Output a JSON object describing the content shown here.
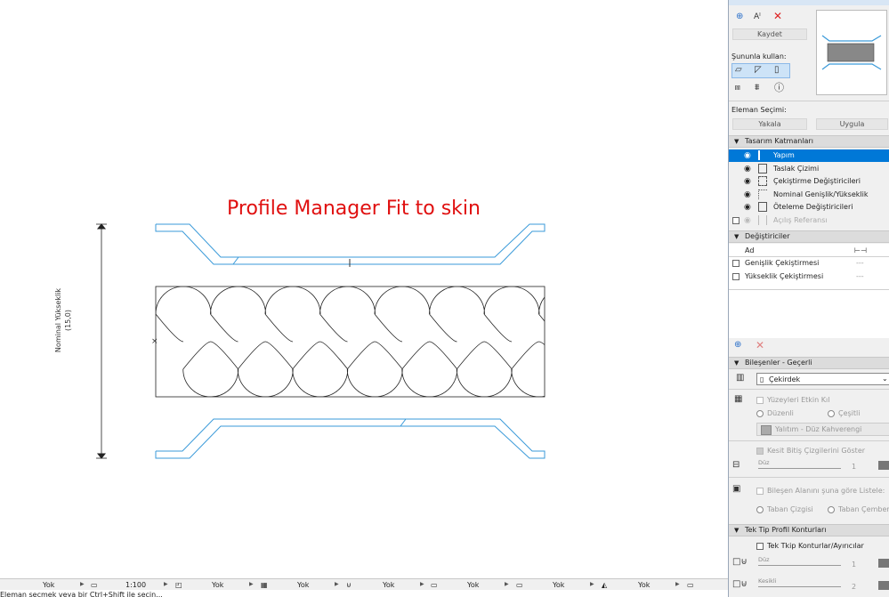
{
  "drawing": {
    "title": "Profile Manager Fit to skin",
    "dimension_label": "Nominal Yükseklik",
    "dimension_value": "(15,0)"
  },
  "panel": {
    "top_title": "...",
    "kaydet": "Kaydet",
    "sununla_kullan": "Şununla kullan:",
    "eleman_secimi": "Eleman Seçimi:",
    "yakala": "Yakala",
    "uygula": "Uygula",
    "section_design_layers": "Tasarım Katmanları",
    "layers": [
      {
        "label": "Yapım"
      },
      {
        "label": "Taslak Çizimi"
      },
      {
        "label": "Çekiştirme Değiştiricileri"
      },
      {
        "label": "Nominal Genişlik/Yükseklik"
      },
      {
        "label": "Öteleme Değiştiricileri"
      },
      {
        "label": "Açılış Referansı"
      }
    ],
    "section_modifiers": "Değiştiriciler",
    "modifiers_col_name": "Ad",
    "modifiers": [
      {
        "label": "Genişlik Çekiştirmesi",
        "value": "---"
      },
      {
        "label": "Yükseklik Çekiştirmesi",
        "value": "---"
      }
    ],
    "section_components": "Bileşenler - Geçerli",
    "component_select": "Çekirdek",
    "yuzeyleri_etkin_kil": "Yüzeyleri Etkin Kıl",
    "duzenli": "Düzenli",
    "cesitli": "Çeşitli",
    "material": "Yalıtım - Düz Kahverengi",
    "kesit_bitis": "Kesit Bitiş Çizgilerini Göster",
    "line_type_1": "Düz",
    "pen_1": "1",
    "bilesen_alani": "Bileşen Alanını şuna göre Listele:",
    "taban_cizgisi": "Taban Çizgisi",
    "taban_cemberi": "Taban Çemberi",
    "section_contours": "Tek Tip Profil Konturları",
    "tek_tip": "Tek Tkip Konturlar/Ayırıcılar",
    "line_type_2": "Düz",
    "pen_2": "1",
    "line_type_3": "Kesikli",
    "pen_3": "2"
  },
  "status": {
    "seg1": "Yok",
    "scale": "1:100",
    "seg2": "Yok",
    "seg3": "Yok",
    "seg4": "Yok",
    "seg5": "Yok",
    "seg6": "Yok",
    "seg7": "Yok"
  },
  "bottom_message": "Eleman seçmek veya bir Ctrl+Shift ile seçin..."
}
